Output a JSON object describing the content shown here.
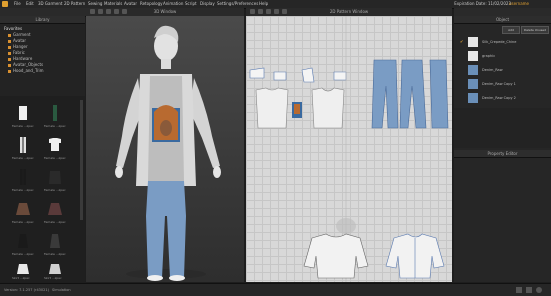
{
  "menu": [
    "File",
    "Edit",
    "3D Garment",
    "2D Pattern",
    "Sewing",
    "Materials",
    "Avatar",
    "Retopology",
    "Animation",
    "Script",
    "Display",
    "Settings/Preferences",
    "Help"
  ],
  "expiration": "Expiration Date: 11/02/2023",
  "user": "username",
  "panels": {
    "library": "Library",
    "view3d": "3D Window",
    "view2d": "2D Pattern Window",
    "object_browser": "Object",
    "property_editor": "Property Editor"
  },
  "library": {
    "favorites_label": "Favorites",
    "items": [
      "Garment",
      "Avatar",
      "Hanger",
      "Fabric",
      "Hardware",
      "Avatar_Objects",
      "Hood_and_Trim"
    ]
  },
  "library_grid": [
    {
      "label": "Female ...zpac"
    },
    {
      "label": "Female ...zpac"
    },
    {
      "label": "Female ...zpac"
    },
    {
      "label": "Female ...zpac"
    },
    {
      "label": "Female ...zpac"
    },
    {
      "label": "Female ...zpac"
    },
    {
      "label": "Female ...zpac"
    },
    {
      "label": "Female ...zpac"
    },
    {
      "label": "Female ...zpac"
    },
    {
      "label": "Female ...zpac"
    },
    {
      "label": "Skirt ...zpac"
    },
    {
      "label": "Skirt ...zpac"
    }
  ],
  "object_browser": {
    "add_button": "Add",
    "delete_button": "Delete Unused",
    "fabrics": [
      {
        "name": "Silk_Crepede_Chine",
        "color": "#e6e6e6"
      },
      {
        "name": "graphic",
        "color": "#e8e8e8"
      },
      {
        "name": "Denim_Raw",
        "color": "#6a8fb8"
      },
      {
        "name": "Denim_Raw Copy 1",
        "color": "#6a8fb8"
      },
      {
        "name": "Denim_Raw Copy 2",
        "color": "#6a8fb8"
      }
    ]
  },
  "status": {
    "version": "Version: 7.1.257 (r43021)",
    "simulation": "Simulation"
  }
}
